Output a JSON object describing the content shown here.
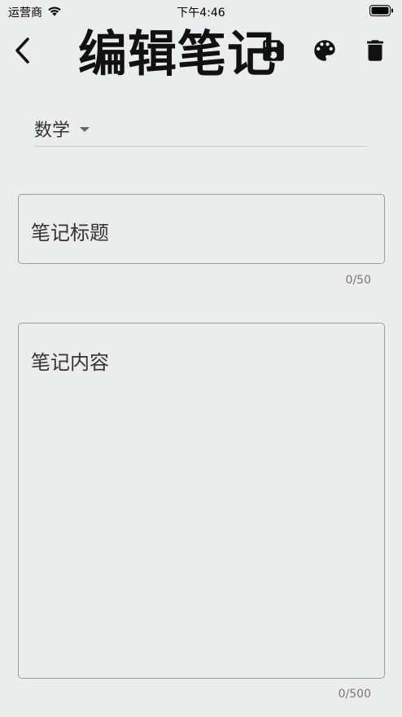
{
  "status_bar": {
    "carrier": "运营商",
    "time": "下午4:46"
  },
  "toolbar": {
    "title": "编辑笔记",
    "icons": [
      "back-icon",
      "save-icon",
      "palette-icon",
      "delete-icon"
    ]
  },
  "form": {
    "category": "数学",
    "title_placeholder": "笔记标题",
    "title_counter": "0/50",
    "content_placeholder": "笔记内容",
    "content_counter": "0/500"
  }
}
